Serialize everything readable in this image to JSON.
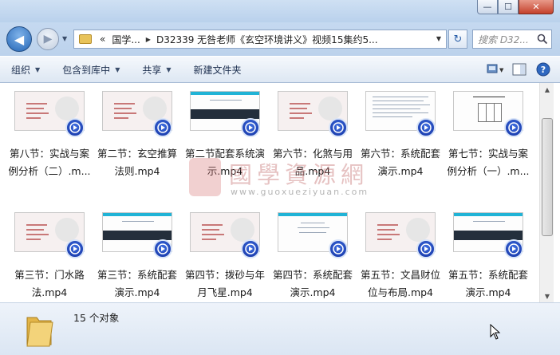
{
  "window": {
    "controls": {
      "minimize": "—",
      "maximize": "☐",
      "close": "✕"
    }
  },
  "navigation": {
    "back_glyph": "◀",
    "forward_glyph": "▶",
    "breadcrumb_prefix": "«",
    "breadcrumbs": [
      "国学...",
      "D32339 无咎老师《玄空环境讲义》视频15集约5..."
    ],
    "search_placeholder": "搜索 D32...",
    "refresh_glyph": "↻"
  },
  "toolbar": {
    "items": [
      {
        "label": "组织",
        "dropdown": true
      },
      {
        "label": "包含到库中",
        "dropdown": true
      },
      {
        "label": "共享",
        "dropdown": true
      },
      {
        "label": "新建文件夹",
        "dropdown": false
      }
    ],
    "right_icons": [
      "view-options-icon",
      "preview-pane-icon",
      "help-icon"
    ]
  },
  "files": [
    {
      "name_lines": [
        "第八节：实战与案",
        "例分析（二）.m..."
      ],
      "thumb": "pink"
    },
    {
      "name_lines": [
        "第二节：玄空推算",
        "法则.mp4"
      ],
      "thumb": "pink"
    },
    {
      "name_lines": [
        "第二节配套系统演",
        "示.mp4"
      ],
      "thumb": "dark"
    },
    {
      "name_lines": [
        "第六节：化煞与用",
        "品.mp4"
      ],
      "thumb": "pink"
    },
    {
      "name_lines": [
        "第六节：系统配套",
        "演示.mp4"
      ],
      "thumb": "doc"
    },
    {
      "name_lines": [
        "第七节：实战与案",
        "例分析（一）.m..."
      ],
      "thumb": "grid"
    },
    {
      "name_lines": [
        "第三节：门水路",
        "法.mp4"
      ],
      "thumb": "pink"
    },
    {
      "name_lines": [
        "第三节：系统配套",
        "演示.mp4"
      ],
      "thumb": "dark"
    },
    {
      "name_lines": [
        "第四节：拨砂与年",
        "月飞星.mp4"
      ],
      "thumb": "pink"
    },
    {
      "name_lines": [
        "第四节：系统配套",
        "演示.mp4"
      ],
      "thumb": "light"
    },
    {
      "name_lines": [
        "第五节：文昌财位",
        "位与布局.mp4"
      ],
      "thumb": "pink"
    },
    {
      "name_lines": [
        "第五节：系统配套",
        "演示.mp4"
      ],
      "thumb": "dark"
    }
  ],
  "watermark": {
    "title": "國學資源網",
    "url": "www.guoxueziyuan.com"
  },
  "status": {
    "count_text": "15 个对象"
  }
}
